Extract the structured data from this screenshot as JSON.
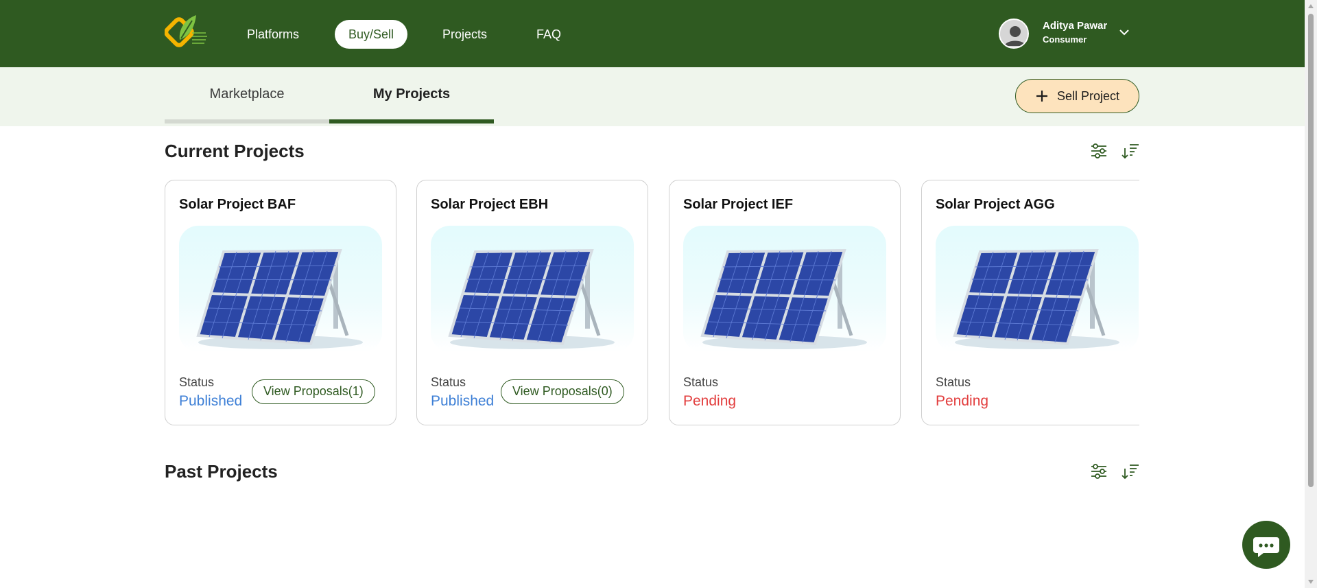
{
  "header": {
    "nav": [
      {
        "label": "Platforms",
        "active": false
      },
      {
        "label": "Buy/Sell",
        "active": true
      },
      {
        "label": "Projects",
        "active": false
      },
      {
        "label": "FAQ",
        "active": false
      }
    ],
    "user": {
      "name": "Aditya Pawar",
      "role": "Consumer"
    }
  },
  "tabs": [
    {
      "label": "Marketplace",
      "active": false
    },
    {
      "label": "My Projects",
      "active": true
    }
  ],
  "sell_button": {
    "label": "Sell Project",
    "icon": "plus-icon"
  },
  "current": {
    "title": "Current Projects",
    "projects": [
      {
        "name": "Solar Project BAF",
        "status_label": "Status",
        "status": "Published",
        "action": "View Proposals(1)"
      },
      {
        "name": "Solar Project EBH",
        "status_label": "Status",
        "status": "Published",
        "action": "View Proposals(0)"
      },
      {
        "name": "Solar Project IEF",
        "status_label": "Status",
        "status": "Pending",
        "action": ""
      },
      {
        "name": "Solar Project AGG",
        "status_label": "Status",
        "status": "Pending",
        "action": ""
      }
    ]
  },
  "past": {
    "title": "Past Projects"
  },
  "colors": {
    "brand": "#2f5a21",
    "tab_bg": "#eff5ec",
    "sell_bg": "#fde3bd",
    "published": "#3d7fd6",
    "pending": "#e23d3d"
  },
  "icons": [
    "filter-icon",
    "sort-icon",
    "chat-icon",
    "avatar-icon",
    "chevron-down-icon",
    "plus-icon"
  ]
}
